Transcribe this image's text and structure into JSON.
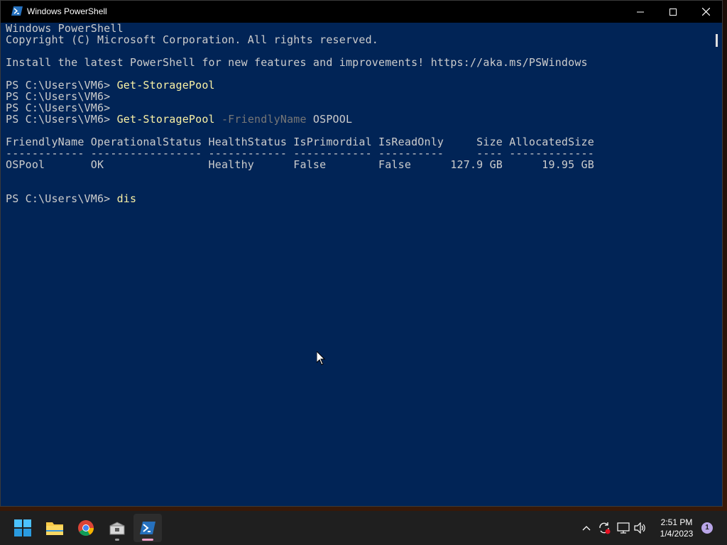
{
  "window": {
    "title": "Windows PowerShell"
  },
  "console": {
    "lines": {
      "l1": "Windows PowerShell",
      "l2": "Copyright (C) Microsoft Corporation. All rights reserved.",
      "l3": "Install the latest PowerShell for new features and improvements! https://aka.ms/PSWindows",
      "p1_prompt": "PS C:\\Users\\VM6> ",
      "p1_cmd": "Get-StoragePool",
      "p2_prompt": "PS C:\\Users\\VM6>",
      "p3_prompt": "PS C:\\Users\\VM6>",
      "p4_prompt": "PS C:\\Users\\VM6> ",
      "p4_cmd": "Get-StoragePool",
      "p4_param": " -FriendlyName",
      "p4_arg": " OSPOOL",
      "table_header": "FriendlyName OperationalStatus HealthStatus IsPrimordial IsReadOnly     Size AllocatedSize",
      "table_sep": "------------ ----------------- ------------ ------------ ----------     ---- -------------",
      "table_row": "OSPool       OK                Healthy      False        False      127.9 GB      19.95 GB",
      "p5_prompt": "PS C:\\Users\\VM6> ",
      "p5_cmd": "dis"
    },
    "colors": {
      "background": "#012456",
      "text": "#cccccc",
      "command": "#f9f1a5",
      "parameter": "#767676"
    }
  },
  "taskbar": {
    "apps": [
      "start-icon",
      "file-explorer-icon",
      "chrome-icon",
      "package-installer-icon",
      "powershell-icon"
    ],
    "clock": {
      "time": "2:51 PM",
      "date": "1/4/2023"
    },
    "notification_count": "1"
  }
}
